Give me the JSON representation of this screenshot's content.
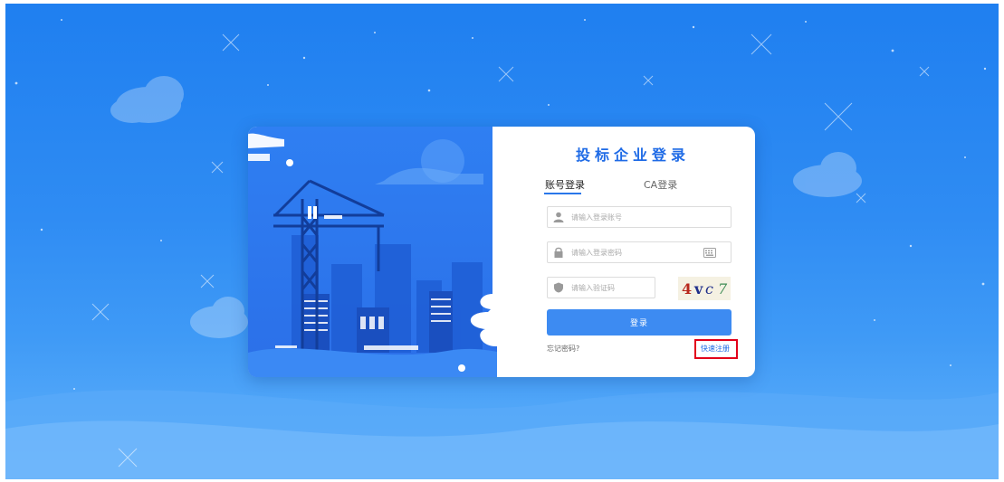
{
  "login": {
    "title": "投标企业登录",
    "tabs": [
      {
        "label": "账号登录",
        "active": true
      },
      {
        "label": "CA登录",
        "active": false
      }
    ],
    "account_placeholder": "请输入登录账号",
    "password_placeholder": "请输入登录密码",
    "captcha_placeholder": "请输入验证码",
    "captcha_chars": [
      "4",
      "v",
      "c",
      "7"
    ],
    "captcha_colors": [
      "#b8281d",
      "#1f2e8a",
      "#1f2e8a",
      "#3e8c54"
    ],
    "login_button": "登录",
    "forgot_password": "忘记密码?",
    "quick_register": "快速注册"
  },
  "colors": {
    "accent": "#3d8bf2",
    "title": "#1f6be6",
    "highlight": "#e2001a"
  },
  "icons": [
    "user-icon",
    "lock-icon",
    "shield-icon",
    "keyboard-icon"
  ]
}
